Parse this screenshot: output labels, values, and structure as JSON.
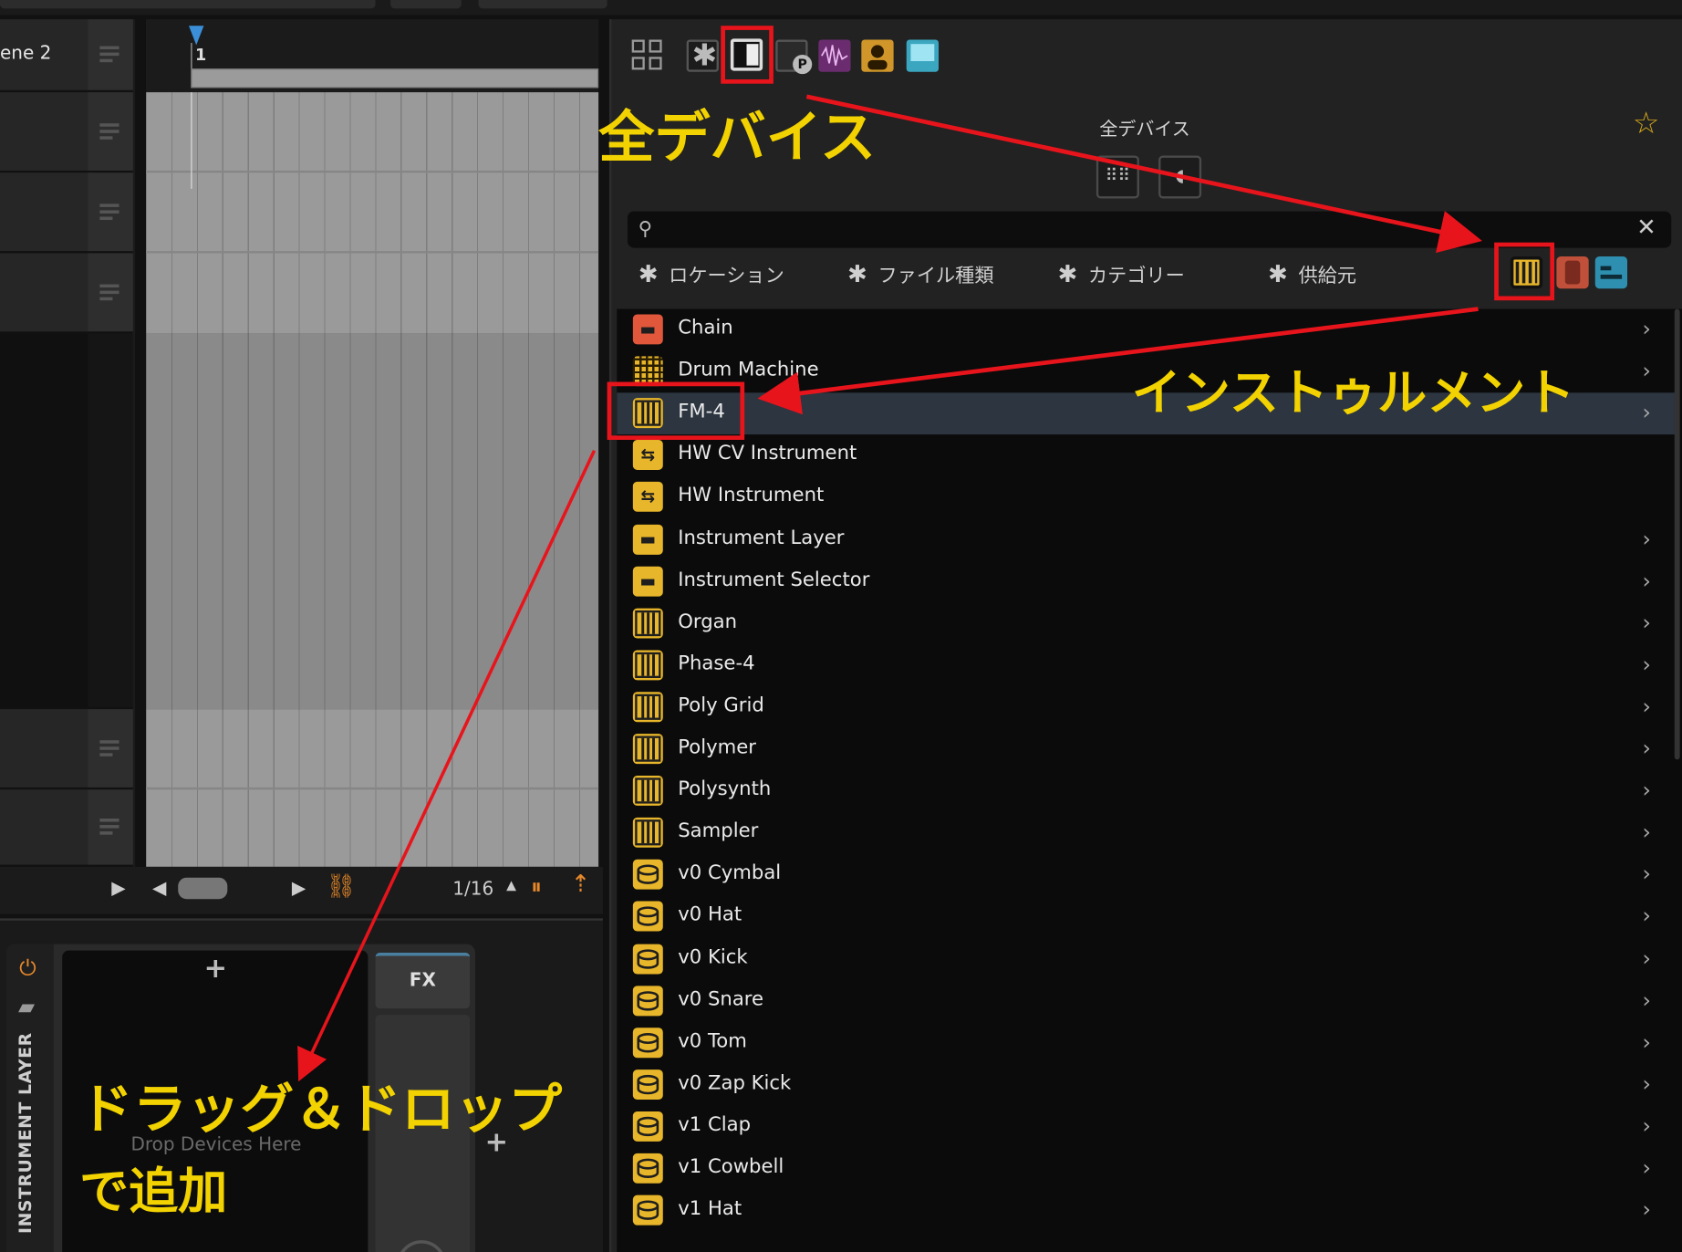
{
  "scene": {
    "label": "ene 2"
  },
  "arranger": {
    "bar_number": "1",
    "grid_resolution": "1/16"
  },
  "device_panel": {
    "layer_label": "INSTRUMENT LAYER",
    "drop_text": "Drop Devices Here",
    "fx_label": "FX",
    "plus": "+"
  },
  "browser": {
    "header_title": "全デバイス",
    "search": {
      "value": "",
      "placeholder": ""
    },
    "filters": [
      {
        "label": "ロケーション"
      },
      {
        "label": "ファイル種類"
      },
      {
        "label": "カテゴリー"
      },
      {
        "label": "供給元"
      }
    ],
    "items": [
      {
        "label": "Chain",
        "icon": "chain-icon"
      },
      {
        "label": "Drum Machine",
        "icon": "drum-machine-icon"
      },
      {
        "label": "FM-4",
        "icon": "piano-icon",
        "selected": true
      },
      {
        "label": "HW CV Instrument",
        "icon": "hardware-icon"
      },
      {
        "label": "HW Instrument",
        "icon": "hardware-icon"
      },
      {
        "label": "Instrument Layer",
        "icon": "layer-icon"
      },
      {
        "label": "Instrument Selector",
        "icon": "layer-icon"
      },
      {
        "label": "Organ",
        "icon": "piano-icon"
      },
      {
        "label": "Phase-4",
        "icon": "piano-icon"
      },
      {
        "label": "Poly Grid",
        "icon": "piano-icon"
      },
      {
        "label": "Polymer",
        "icon": "piano-icon"
      },
      {
        "label": "Polysynth",
        "icon": "piano-icon"
      },
      {
        "label": "Sampler",
        "icon": "piano-icon"
      },
      {
        "label": "v0 Cymbal",
        "icon": "drum-icon"
      },
      {
        "label": "v0 Hat",
        "icon": "drum-icon"
      },
      {
        "label": "v0 Kick",
        "icon": "drum-icon"
      },
      {
        "label": "v0 Snare",
        "icon": "drum-icon"
      },
      {
        "label": "v0 Tom",
        "icon": "drum-icon"
      },
      {
        "label": "v0 Zap Kick",
        "icon": "drum-icon"
      },
      {
        "label": "v1 Clap",
        "icon": "drum-icon"
      },
      {
        "label": "v1 Cowbell",
        "icon": "drum-icon"
      },
      {
        "label": "v1 Hat",
        "icon": "drum-icon"
      }
    ]
  },
  "annotations": {
    "all_devices": "全デバイス",
    "instrument": "インストゥルメント",
    "drag_drop_line1": "ドラッグ＆ドロップ",
    "drag_drop_line2": "で追加"
  },
  "colors": {
    "accent_yellow": "#e8b62a",
    "annotation_red": "#e8141c",
    "annotation_text": "#f2d200",
    "selection_row": "#2c3540"
  }
}
